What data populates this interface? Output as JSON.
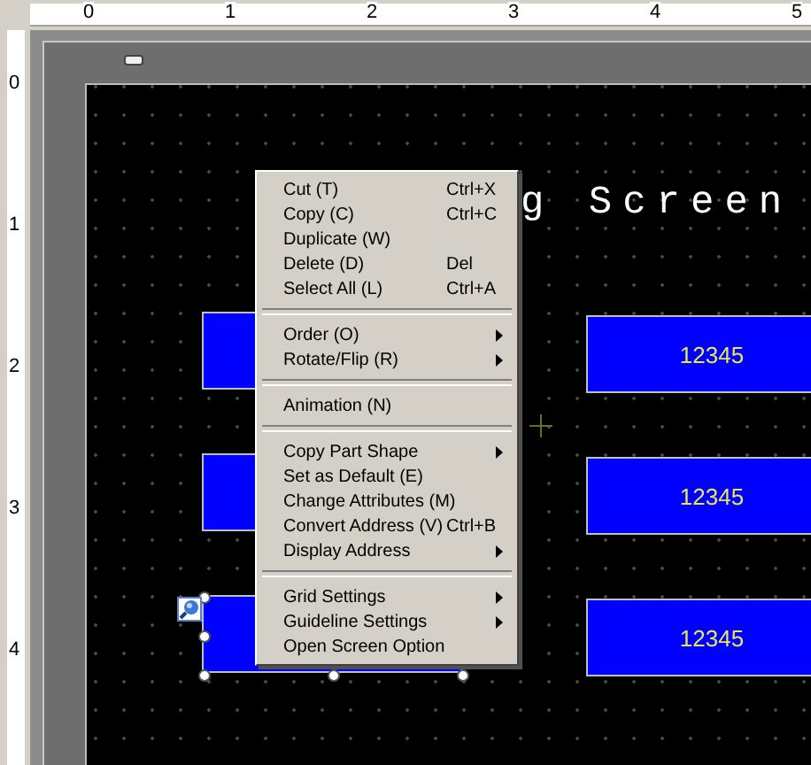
{
  "rulers": {
    "horizontal": [
      "0",
      "1",
      "2",
      "3",
      "4",
      "5"
    ],
    "vertical": [
      "0",
      "1",
      "2",
      "3",
      "4"
    ]
  },
  "screen": {
    "title": "g Screen",
    "left_parts": [
      {
        "selected": false
      },
      {
        "selected": false
      },
      {
        "selected": true
      }
    ],
    "right_parts": [
      {
        "value": "12345"
      },
      {
        "value": "12345"
      },
      {
        "value": "12345"
      }
    ]
  },
  "context_menu": [
    {
      "kind": "item",
      "label": "Cut (T)",
      "shortcut": "Ctrl+X",
      "submenu": false
    },
    {
      "kind": "item",
      "label": "Copy (C)",
      "shortcut": "Ctrl+C",
      "submenu": false
    },
    {
      "kind": "item",
      "label": "Duplicate (W)",
      "submenu": false
    },
    {
      "kind": "item",
      "label": "Delete (D)",
      "shortcut": "Del",
      "submenu": false
    },
    {
      "kind": "item",
      "label": "Select All (L)",
      "shortcut": "Ctrl+A",
      "submenu": false
    },
    {
      "kind": "separator"
    },
    {
      "kind": "item",
      "label": "Order (O)",
      "submenu": true
    },
    {
      "kind": "item",
      "label": "Rotate/Flip (R)",
      "submenu": true
    },
    {
      "kind": "separator"
    },
    {
      "kind": "item",
      "label": "Animation (N)",
      "submenu": false
    },
    {
      "kind": "separator"
    },
    {
      "kind": "item",
      "label": "Copy Part Shape",
      "submenu": true
    },
    {
      "kind": "item",
      "label": "Set as Default (E)",
      "submenu": false
    },
    {
      "kind": "item",
      "label": "Change Attributes (M)",
      "submenu": false
    },
    {
      "kind": "item",
      "label": "Convert Address (V)",
      "shortcut": "Ctrl+B",
      "submenu": false
    },
    {
      "kind": "item",
      "label": "Display Address",
      "submenu": true
    },
    {
      "kind": "separator"
    },
    {
      "kind": "item",
      "label": "Grid Settings",
      "submenu": true
    },
    {
      "kind": "item",
      "label": "Guideline Settings",
      "submenu": true
    },
    {
      "kind": "item",
      "label": "Open Screen Option",
      "submenu": false
    }
  ]
}
